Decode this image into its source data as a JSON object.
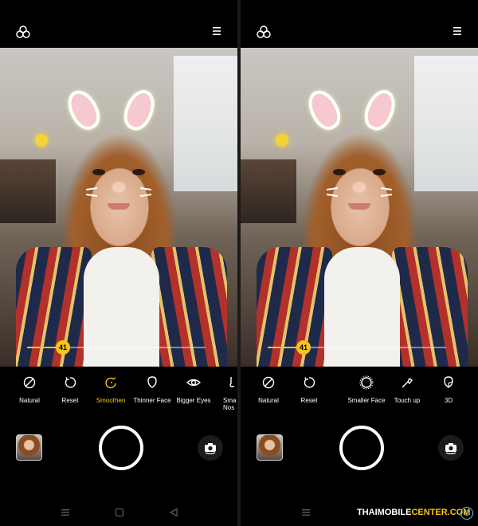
{
  "left_panel": {
    "slider_value": "41",
    "slider_level": 0.2,
    "tools": [
      {
        "label": "Natural",
        "icon": "no-effect-icon",
        "active": false
      },
      {
        "label": "Reset",
        "icon": "reset-icon",
        "active": false
      },
      {
        "label": "Smoothen",
        "icon": "smoothen-icon",
        "active": true
      },
      {
        "label": "Thinner Face",
        "icon": "thinner-face-icon",
        "active": false
      },
      {
        "label": "Bigger Eyes",
        "icon": "bigger-eyes-icon",
        "active": false
      },
      {
        "label": "Sma Nos",
        "icon": "smaller-nose-icon",
        "active": false
      }
    ]
  },
  "right_panel": {
    "slider_value": "41",
    "slider_level": 0.2,
    "tools": [
      {
        "label": "Natural",
        "icon": "no-effect-icon",
        "active": false
      },
      {
        "label": "Reset",
        "icon": "reset-icon",
        "active": false
      },
      {
        "label": "Smaller Face",
        "icon": "smaller-face-icon",
        "active": false
      },
      {
        "label": "Touch up",
        "icon": "touch-up-icon",
        "active": false
      },
      {
        "label": "3D",
        "icon": "3d-icon",
        "active": false
      }
    ]
  },
  "watermark": {
    "text": "THAIMOBILECENTER.COM",
    "prefix": "THAIMOBILE",
    "suffix": "CENTER.COM",
    "mark": "C"
  },
  "colors": {
    "accent": "#f5c51a",
    "background": "#000000"
  }
}
